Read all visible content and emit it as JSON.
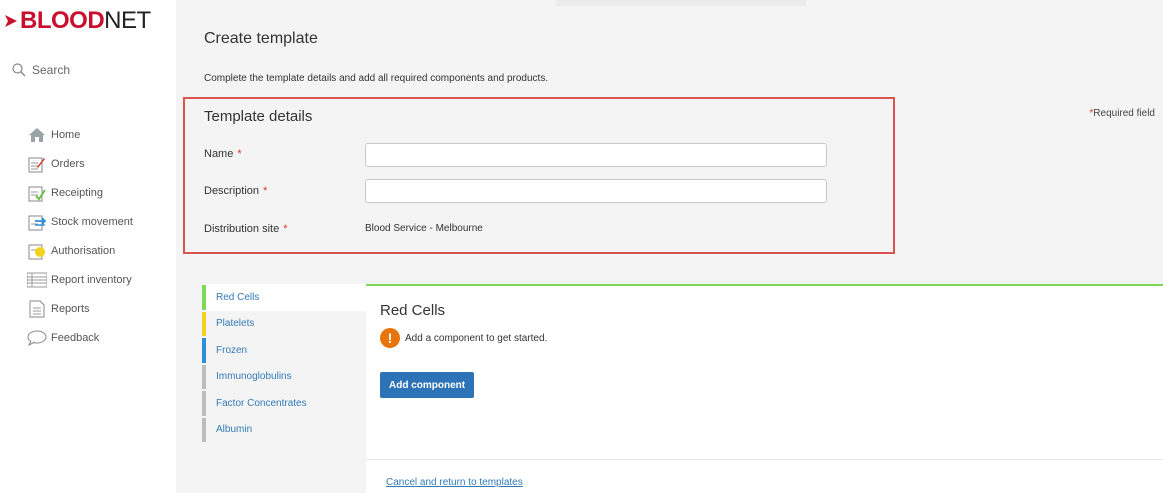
{
  "brand": {
    "name_part1": "BLOOD",
    "name_part2": "NET",
    "drop_color": "#c8102e"
  },
  "sidebar": {
    "search_label": "Search",
    "items": [
      {
        "label": "Home",
        "icon": "home-icon"
      },
      {
        "label": "Orders",
        "icon": "orders-icon"
      },
      {
        "label": "Receipting",
        "icon": "receipting-icon"
      },
      {
        "label": "Stock movement",
        "icon": "stock-movement-icon"
      },
      {
        "label": "Authorisation",
        "icon": "authorisation-icon"
      },
      {
        "label": "Report inventory",
        "icon": "report-inventory-icon"
      },
      {
        "label": "Reports",
        "icon": "reports-icon"
      },
      {
        "label": "Feedback",
        "icon": "feedback-icon"
      }
    ]
  },
  "page": {
    "title": "Create template",
    "intro": "Complete the template details and add all required components and products.",
    "required_note": "Required field"
  },
  "template_details": {
    "title": "Template details",
    "name_label": "Name",
    "name_value": "",
    "description_label": "Description",
    "description_value": "",
    "distribution_label": "Distribution site",
    "distribution_value": "Blood Service - Melbourne",
    "required_marker": "*"
  },
  "tabs": [
    {
      "label": "Red Cells",
      "color": "#7ed957",
      "active": true
    },
    {
      "label": "Platelets",
      "color": "#f2d21c",
      "active": false
    },
    {
      "label": "Frozen",
      "color": "#2d8fd8",
      "active": false
    },
    {
      "label": "Immunoglobulins",
      "color": "#bdbdbd",
      "active": false
    },
    {
      "label": "Factor Concentrates",
      "color": "#bdbdbd",
      "active": false
    },
    {
      "label": "Albumin",
      "color": "#bdbdbd",
      "active": false
    }
  ],
  "panel": {
    "title": "Red Cells",
    "alert_text": "Add a component to get started.",
    "alert_icon": "!",
    "add_button": "Add component",
    "cancel_link": "Cancel and return to templates"
  },
  "colors": {
    "accent_blue": "#2d73b8",
    "link_blue": "#337ab7",
    "required_red": "#d9342b",
    "highlight_red": "#d9534f",
    "alert_orange": "#e8740c"
  }
}
